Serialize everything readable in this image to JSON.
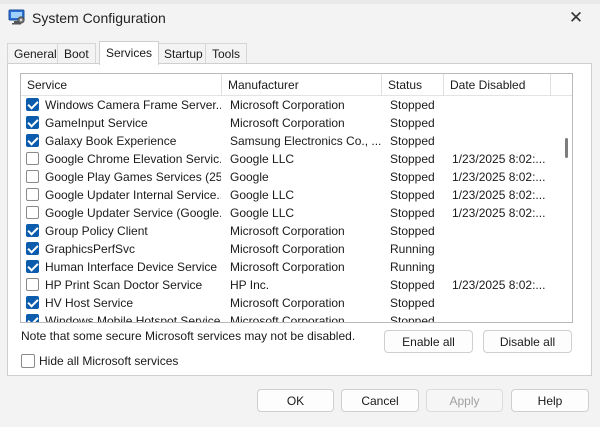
{
  "window": {
    "title": "System Configuration"
  },
  "tabs": [
    {
      "label": "General"
    },
    {
      "label": "Boot"
    },
    {
      "label": "Services"
    },
    {
      "label": "Startup"
    },
    {
      "label": "Tools"
    }
  ],
  "active_tab": "Services",
  "table": {
    "columns": [
      "Service",
      "Manufacturer",
      "Status",
      "Date Disabled"
    ],
    "rows": [
      {
        "checked": true,
        "service": "Windows Camera Frame Server...",
        "manufacturer": "Microsoft Corporation",
        "status": "Stopped",
        "date": ""
      },
      {
        "checked": true,
        "service": "GameInput Service",
        "manufacturer": "Microsoft Corporation",
        "status": "Stopped",
        "date": ""
      },
      {
        "checked": true,
        "service": "Galaxy Book Experience",
        "manufacturer": "Samsung Electronics Co., ...",
        "status": "Stopped",
        "date": ""
      },
      {
        "checked": false,
        "service": "Google Chrome Elevation Servic...",
        "manufacturer": "Google LLC",
        "status": "Stopped",
        "date": "1/23/2025 8:02:..."
      },
      {
        "checked": false,
        "service": "Google Play Games Services (25...",
        "manufacturer": "Google",
        "status": "Stopped",
        "date": "1/23/2025 8:02:..."
      },
      {
        "checked": false,
        "service": "Google Updater Internal Service...",
        "manufacturer": "Google LLC",
        "status": "Stopped",
        "date": "1/23/2025 8:02:..."
      },
      {
        "checked": false,
        "service": "Google Updater Service (Google...",
        "manufacturer": "Google LLC",
        "status": "Stopped",
        "date": "1/23/2025 8:02:..."
      },
      {
        "checked": true,
        "service": "Group Policy Client",
        "manufacturer": "Microsoft Corporation",
        "status": "Stopped",
        "date": ""
      },
      {
        "checked": true,
        "service": "GraphicsPerfSvc",
        "manufacturer": "Microsoft Corporation",
        "status": "Running",
        "date": ""
      },
      {
        "checked": true,
        "service": "Human Interface Device Service",
        "manufacturer": "Microsoft Corporation",
        "status": "Running",
        "date": ""
      },
      {
        "checked": false,
        "service": "HP Print Scan Doctor Service",
        "manufacturer": "HP Inc.",
        "status": "Stopped",
        "date": "1/23/2025 8:02:..."
      },
      {
        "checked": true,
        "service": "HV Host Service",
        "manufacturer": "Microsoft Corporation",
        "status": "Stopped",
        "date": ""
      },
      {
        "checked": true,
        "service": "Windows Mobile Hotspot Service",
        "manufacturer": "Microsoft Corporation",
        "status": "Stopped",
        "date": ""
      }
    ]
  },
  "note": "Note that some secure Microsoft services may not be disabled.",
  "buttons": {
    "enable_all": "Enable all",
    "disable_all": "Disable all",
    "ok": "OK",
    "cancel": "Cancel",
    "apply": "Apply",
    "help": "Help"
  },
  "hide_ms": {
    "label": "Hide all Microsoft services",
    "checked": false
  },
  "colors": {
    "accent": "#0b5cad",
    "panel": "#ffffff",
    "window": "#f3f3f3"
  }
}
